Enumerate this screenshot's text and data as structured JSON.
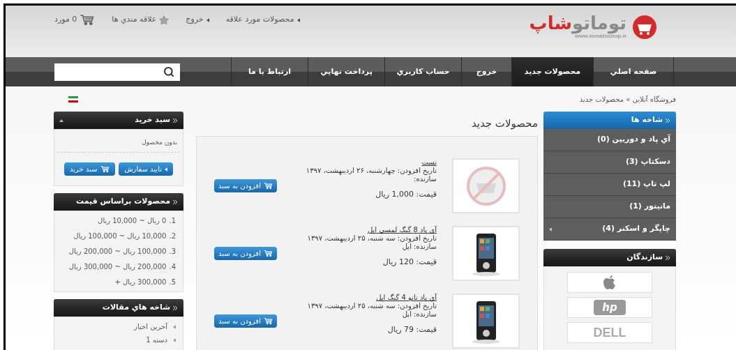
{
  "header": {
    "logo": {
      "name_main": "توماتو",
      "name_accent": "شاپ",
      "url": "www.tomatoshop.ir"
    },
    "top_links": [
      {
        "kind": "link",
        "label": "محصولات مورد علاقه"
      },
      {
        "kind": "link",
        "label": "خروج"
      },
      {
        "kind": "wishlist",
        "label": "علاقه مندي ها"
      },
      {
        "kind": "cart",
        "label": "0 مورد"
      }
    ]
  },
  "nav": [
    {
      "label": "صفحه اصلي",
      "selected": false
    },
    {
      "label": "محصولات جديد",
      "selected": true
    },
    {
      "label": "خروج",
      "selected": false
    },
    {
      "label": "حساب كاربري",
      "selected": false
    },
    {
      "label": "پرداخت نهايي",
      "selected": false
    },
    {
      "label": "ارتباط با ما",
      "selected": false
    }
  ],
  "breadcrumb": "فروشگاه آنلاين » محصولات جديد",
  "categories": {
    "title": "شاخه ها",
    "items": [
      {
        "label": "آي پاد و دوربين (0)",
        "has_children": false
      },
      {
        "label": "دسكتاپ (3)",
        "has_children": false
      },
      {
        "label": "لپ تاپ (11)",
        "has_children": false
      },
      {
        "label": "مانيتور (1)",
        "has_children": false
      },
      {
        "label": "چاپگر و اسكنر (4)",
        "has_children": true
      }
    ]
  },
  "manufacturers": {
    "title": "سازندگان",
    "logos": [
      {
        "kind": "apple"
      },
      {
        "kind": "hp",
        "text": "hp"
      },
      {
        "kind": "dell",
        "text": "DELL"
      }
    ]
  },
  "content": {
    "title": "محصولات جديد",
    "products": [
      {
        "kind": "placeholder",
        "name": "تست",
        "date": "تاريخ افزودن: چهارشنبه، ۲۶ ارديبهشت، ۱۳۹۷",
        "maker": "سازنده:",
        "price": "قيمت: 1,000 ريال",
        "button": "افزودن به سبد"
      },
      {
        "kind": "picture",
        "name": "آي پاد 8 گيگ لمسي اپل",
        "date": "تاريخ افزودن: سه شنبه، ۲۵ ارديبهشت، ۱۳۹۷",
        "maker": "سازنده: اپل",
        "price": "قيمت: 120 ريال",
        "button": "افزودن به سبد"
      },
      {
        "kind": "picture",
        "name": "آي پاد نانو 4 گيگ اپل",
        "date": "تاريخ افزودن: سه شنبه، ۲۵ ارديبهشت، ۱۳۹۷",
        "maker": "سازنده: اپل",
        "price": "قيمت: 79 ريال",
        "button": "افزودن به سبد"
      }
    ]
  },
  "cart": {
    "title": "سبد خريد",
    "empty_text": "بدون محصول",
    "checkout_button": "تاييد سفارش",
    "cart_button": "سبد خريد"
  },
  "price_ranges": {
    "title": "محصولات براساس قيمت",
    "items": [
      {
        "number": "1.",
        "label": "0 ريال ~ 10,000 ريال"
      },
      {
        "number": "2.",
        "label": "10,000 ريال ~ 100,000 ريال"
      },
      {
        "number": "3.",
        "label": "100,000 ريال ~ 200,000 ريال"
      },
      {
        "number": "4.",
        "label": "200,000 ريال ~ 300,000 ريال"
      },
      {
        "number": "5.",
        "label": "300,000 ريال +"
      }
    ]
  },
  "article_categories": {
    "title": "شاخه هاي مقالات",
    "items": [
      "آخرين اخبار",
      "دسته 1"
    ]
  }
}
